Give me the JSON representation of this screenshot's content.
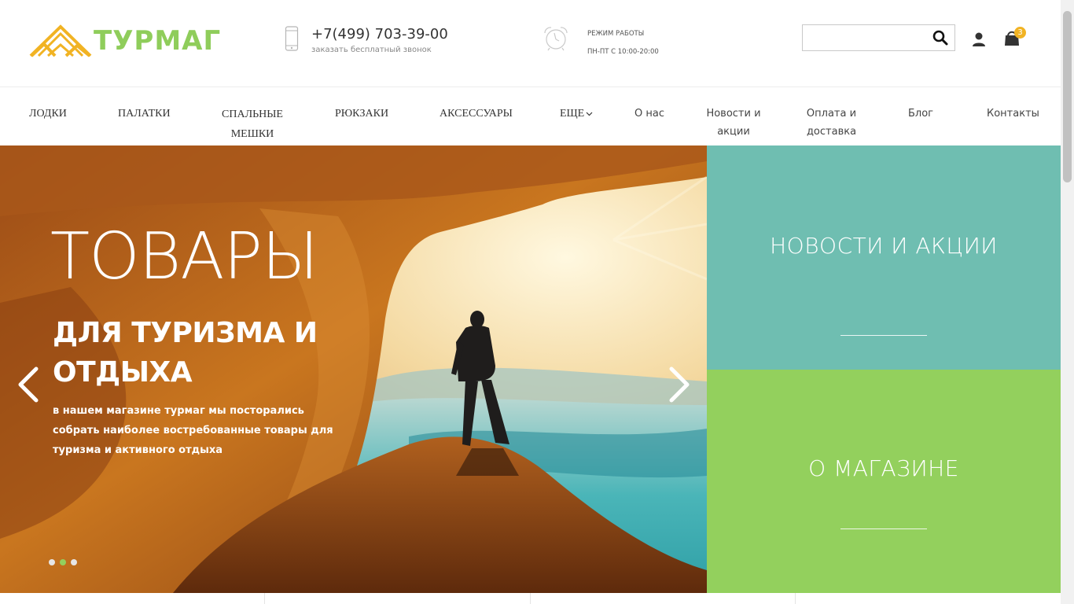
{
  "brand": {
    "name": "ТУРМАГ",
    "logo_color": "#8fcd5b",
    "accent": "#f1b323"
  },
  "contact": {
    "phone": "+7(499) 703-39-00",
    "callback": "заказать бесплатный звонок"
  },
  "hours": {
    "title": "РЕЖИМ РАБОТЫ",
    "schedule": "ПН-ПТ С 10:00-20:00"
  },
  "search": {
    "value": "",
    "placeholder": ""
  },
  "cart": {
    "count": "3"
  },
  "nav": {
    "categories": [
      "ЛОДКИ",
      "ПАЛАТКИ",
      "СПАЛЬНЫЕ МЕШКИ",
      "РЮКЗАКИ",
      "АКСЕССУАРЫ",
      "ЕЩЕ"
    ],
    "pages": [
      "О нас",
      "Новости и акции",
      "Оплата и доставка",
      "Блог",
      "Контакты"
    ]
  },
  "hero": {
    "title": "ТОВАРЫ",
    "subtitle": "ДЛЯ ТУРИЗМА И ОТДЫХА",
    "text": "в нашем магазине турмаг мы посторались собрать наиболее востребованные товары для туризма и активного отдыха",
    "slides_count": 3,
    "active_slide": 2
  },
  "banners": {
    "news": {
      "label": "НОВОСТИ И АКЦИИ",
      "color": "#6fbeb1"
    },
    "about": {
      "label": "О МАГАЗИНЕ",
      "color": "#93d05d"
    }
  },
  "icons": [
    "phone-icon",
    "alarm-clock-icon",
    "search-icon",
    "user-icon",
    "shopping-bag-icon",
    "chevron-down-icon",
    "chevron-left-icon",
    "chevron-right-icon"
  ]
}
